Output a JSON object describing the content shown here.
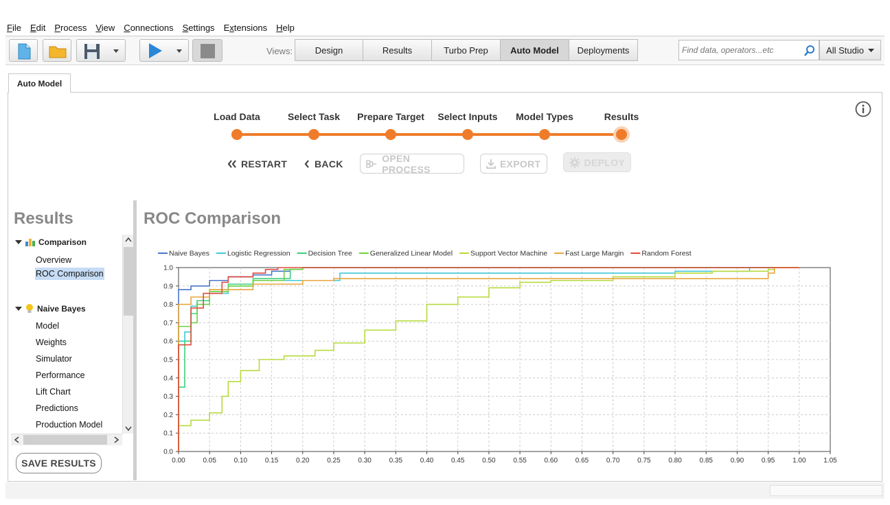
{
  "menu": [
    {
      "label": "File",
      "u": "F",
      "rest": "ile"
    },
    {
      "label": "Edit",
      "u": "E",
      "rest": "dit"
    },
    {
      "label": "Process",
      "u": "P",
      "rest": "rocess"
    },
    {
      "label": "View",
      "u": "V",
      "rest": "iew"
    },
    {
      "label": "Connections",
      "u": "C",
      "rest": "onnections"
    },
    {
      "label": "Settings",
      "u": "S",
      "rest": "ettings"
    },
    {
      "label": "Extensions",
      "u": "x",
      "pre": "E",
      "rest": "tensions"
    },
    {
      "label": "Help",
      "u": "H",
      "rest": "elp"
    }
  ],
  "toolbar": {
    "views_label": "Views:",
    "view_tabs": [
      "Design",
      "Results",
      "Turbo Prep",
      "Auto Model",
      "Deployments"
    ],
    "active_view": "Auto Model",
    "search_placeholder": "Find data, operators...etc",
    "studio_label": "All Studio"
  },
  "doc_tab": "Auto Model",
  "stepper": {
    "steps": [
      "Load Data",
      "Select Task",
      "Prepare Target",
      "Select Inputs",
      "Model Types",
      "Results"
    ],
    "current": "Results",
    "color": "#ef7c2a"
  },
  "actions": {
    "restart": "RESTART",
    "back": "BACK",
    "open_process": "OPEN PROCESS",
    "export": "EXPORT",
    "deploy": "DEPLOY"
  },
  "left_panel": {
    "title": "Results",
    "groups": [
      {
        "label": "Comparison",
        "icon": "comparison-icon",
        "items": [
          "Overview",
          "ROC Comparison"
        ]
      },
      {
        "label": "Naive Bayes",
        "icon": "lightbulb-icon",
        "items": [
          "Model",
          "Weights",
          "Simulator",
          "Performance",
          "Lift Chart",
          "Predictions",
          "Production Model"
        ]
      }
    ],
    "selected": "ROC Comparison",
    "save_button": "SAVE RESULTS"
  },
  "main_title": "ROC Comparison",
  "chart_data": {
    "type": "line",
    "title": "",
    "xlabel": "",
    "ylabel": "",
    "xlim": [
      0,
      1.05
    ],
    "ylim": [
      0,
      1.0
    ],
    "xticks": [
      "0.00",
      "0.05",
      "0.10",
      "0.15",
      "0.20",
      "0.25",
      "0.30",
      "0.35",
      "0.40",
      "0.45",
      "0.50",
      "0.55",
      "0.60",
      "0.65",
      "0.70",
      "0.75",
      "0.80",
      "0.85",
      "0.90",
      "0.95",
      "1.00",
      "1.05"
    ],
    "yticks": [
      "0.0",
      "0.1",
      "0.2",
      "0.3",
      "0.4",
      "0.5",
      "0.6",
      "0.7",
      "0.8",
      "0.9",
      "1.0"
    ],
    "grid": true,
    "legend_position": "top",
    "series": [
      {
        "name": "Naive Bayes",
        "color": "#4a74c9",
        "points": [
          [
            0,
            0
          ],
          [
            0,
            0.88
          ],
          [
            0.02,
            0.88
          ],
          [
            0.02,
            0.9
          ],
          [
            0.04,
            0.9
          ],
          [
            0.05,
            0.93
          ],
          [
            0.08,
            0.93
          ],
          [
            0.08,
            0.95
          ],
          [
            0.12,
            0.96
          ],
          [
            0.15,
            0.98
          ],
          [
            0.18,
            0.99
          ],
          [
            0.2,
            1.0
          ],
          [
            1.0,
            1.0
          ]
        ]
      },
      {
        "name": "Logistic Regression",
        "color": "#40c8d8",
        "points": [
          [
            0,
            0
          ],
          [
            0,
            0.6
          ],
          [
            0.01,
            0.65
          ],
          [
            0.02,
            0.79
          ],
          [
            0.03,
            0.82
          ],
          [
            0.05,
            0.86
          ],
          [
            0.08,
            0.9
          ],
          [
            0.12,
            0.93
          ],
          [
            0.25,
            0.93
          ],
          [
            0.26,
            0.97
          ],
          [
            0.4,
            0.97
          ],
          [
            0.6,
            0.97
          ],
          [
            0.8,
            0.98
          ],
          [
            0.9,
            0.98
          ],
          [
            0.92,
            1.0
          ],
          [
            1.0,
            1.0
          ]
        ]
      },
      {
        "name": "Decision Tree",
        "color": "#3ccf7a",
        "points": [
          [
            0,
            0
          ],
          [
            0,
            0.35
          ],
          [
            0.01,
            0.6
          ],
          [
            0.02,
            0.75
          ],
          [
            0.03,
            0.82
          ],
          [
            0.05,
            0.88
          ],
          [
            0.08,
            0.91
          ],
          [
            0.12,
            0.94
          ],
          [
            0.18,
            0.99
          ],
          [
            0.2,
            1.0
          ],
          [
            1.0,
            1.0
          ]
        ]
      },
      {
        "name": "Generalized Linear Model",
        "color": "#6cd040",
        "points": [
          [
            0,
            0
          ],
          [
            0,
            0.68
          ],
          [
            0.02,
            0.7
          ],
          [
            0.03,
            0.8
          ],
          [
            0.05,
            0.87
          ],
          [
            0.08,
            0.9
          ],
          [
            0.12,
            0.93
          ],
          [
            0.17,
            0.99
          ],
          [
            0.2,
            1.0
          ],
          [
            1.0,
            1.0
          ]
        ]
      },
      {
        "name": "Support Vector Machine",
        "color": "#b7da3c",
        "points": [
          [
            0,
            0
          ],
          [
            0,
            0.14
          ],
          [
            0.02,
            0.14
          ],
          [
            0.02,
            0.17
          ],
          [
            0.04,
            0.17
          ],
          [
            0.05,
            0.21
          ],
          [
            0.07,
            0.3
          ],
          [
            0.08,
            0.38
          ],
          [
            0.1,
            0.44
          ],
          [
            0.13,
            0.5
          ],
          [
            0.17,
            0.52
          ],
          [
            0.22,
            0.55
          ],
          [
            0.25,
            0.59
          ],
          [
            0.3,
            0.66
          ],
          [
            0.35,
            0.71
          ],
          [
            0.4,
            0.8
          ],
          [
            0.45,
            0.84
          ],
          [
            0.5,
            0.89
          ],
          [
            0.55,
            0.92
          ],
          [
            0.6,
            0.93
          ],
          [
            0.7,
            0.95
          ],
          [
            0.8,
            0.97
          ],
          [
            0.86,
            0.98
          ],
          [
            0.95,
            0.99
          ],
          [
            0.96,
            1.0
          ],
          [
            1.0,
            1.0
          ]
        ]
      },
      {
        "name": "Fast Large Margin",
        "color": "#e8a63c",
        "points": [
          [
            0,
            0
          ],
          [
            0,
            0.8
          ],
          [
            0.02,
            0.8
          ],
          [
            0.02,
            0.84
          ],
          [
            0.05,
            0.88
          ],
          [
            0.12,
            0.91
          ],
          [
            0.2,
            0.93
          ],
          [
            0.25,
            0.94
          ],
          [
            0.94,
            0.94
          ],
          [
            0.95,
            0.97
          ],
          [
            0.96,
            1.0
          ],
          [
            1.0,
            1.0
          ]
        ]
      },
      {
        "name": "Random Forest",
        "color": "#e04a3c",
        "points": [
          [
            0,
            0
          ],
          [
            0,
            0.58
          ],
          [
            0.02,
            0.61
          ],
          [
            0.02,
            0.78
          ],
          [
            0.04,
            0.86
          ],
          [
            0.07,
            0.92
          ],
          [
            0.08,
            0.95
          ],
          [
            0.12,
            0.97
          ],
          [
            0.14,
            0.99
          ],
          [
            0.16,
            1.0
          ],
          [
            1.0,
            1.0
          ]
        ]
      }
    ]
  }
}
